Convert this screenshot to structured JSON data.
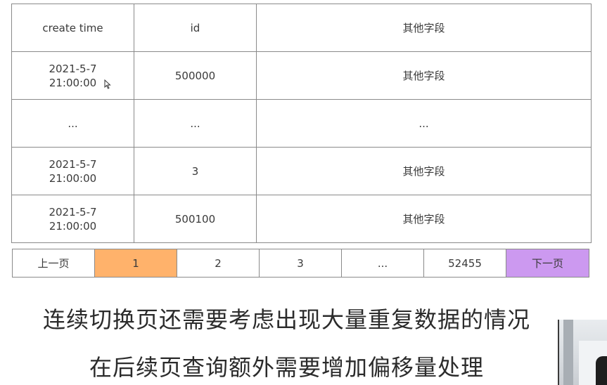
{
  "table": {
    "header": {
      "create_time": "create time",
      "id": "id",
      "other": "其他字段"
    },
    "rows": [
      {
        "date": "2021-5-7",
        "time": "21:00:00",
        "id": "500000",
        "other": "其他字段"
      },
      {
        "date": "...",
        "time": "",
        "id": "...",
        "other": "..."
      },
      {
        "date": "2021-5-7",
        "time": "21:00:00",
        "id": "3",
        "other": "其他字段"
      },
      {
        "date": "2021-5-7",
        "time": "21:00:00",
        "id": "500100",
        "other": "其他字段"
      }
    ]
  },
  "pager": {
    "prev_label": "上一页",
    "pages": [
      "1",
      "2",
      "3",
      "...",
      "52455"
    ],
    "active_page": "1",
    "next_label": "下一页",
    "colors": {
      "active": "#ffb26b",
      "next": "#cc99f0"
    }
  },
  "captions": {
    "line1": "连续切换页还需要考虑出现大量重复数据的情况",
    "line2": "在后续页查询额外需要增加偏移量处理"
  }
}
